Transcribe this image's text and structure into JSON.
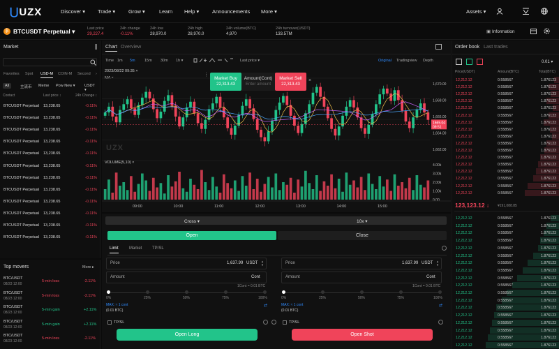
{
  "nav": {
    "logo": "UZX",
    "items": [
      "Discover ▾",
      "Trade ▾",
      "Grow ▾",
      "Learn",
      "Help ▾",
      "Announcements",
      "More ▾"
    ],
    "assets": "Assets ▾"
  },
  "ticker": {
    "symbol": "BTCUSDT Perpetual",
    "stats": [
      {
        "label": "Last price",
        "value": "29,227.4",
        "color": "red"
      },
      {
        "label": "24h change",
        "value": "-0.11%",
        "color": "red"
      },
      {
        "label": "24h low",
        "value": "28,970.0",
        "color": "normal"
      },
      {
        "label": "24h high",
        "value": "28,970.0",
        "color": "normal"
      },
      {
        "label": "24h volume(BTC)",
        "value": "4,970",
        "color": "normal"
      },
      {
        "label": "24h turnover(USDT)",
        "value": "133.5TM",
        "color": "normal"
      }
    ],
    "information": "Information"
  },
  "market": {
    "title": "Market",
    "tabs": [
      "Favorites",
      "Spot",
      "USD-M",
      "COIN-M",
      "Second"
    ],
    "filters": [
      "All",
      "主流币",
      "Meme",
      "Pow New ▾",
      "USDT ▾"
    ],
    "headers": [
      "Contact",
      "Last price ↕",
      "24h Change ↕"
    ],
    "rows": [
      {
        "name": "BTCUSDT Perpetual",
        "price": "13,238.65",
        "change": "-0.11%"
      },
      {
        "name": "BTCUSDT Perpetual",
        "price": "13,238.65",
        "change": "-0.11%"
      },
      {
        "name": "BTCUSDT Perpetual",
        "price": "13,238.65",
        "change": "-0.11%"
      },
      {
        "name": "BTCUSDT Perpetual",
        "price": "13,238.65",
        "change": "-0.11%"
      },
      {
        "name": "BTCUSDT Perpetual",
        "price": "13,238.65",
        "change": "-0.11%"
      },
      {
        "name": "BTCUSDT Perpetual",
        "price": "13,238.65",
        "change": "-0.11%"
      },
      {
        "name": "BTCUSDT Perpetual",
        "price": "13,238.65",
        "change": "-0.11%"
      },
      {
        "name": "BTCUSDT Perpetual",
        "price": "13,238.65",
        "change": "-0.11%"
      },
      {
        "name": "BTCUSDT Perpetual",
        "price": "13,238.65",
        "change": "-0.11%"
      },
      {
        "name": "BTCUSDT Perpetual",
        "price": "13,238.65",
        "change": "-0.11%"
      },
      {
        "name": "BTCUSDT Perpetual",
        "price": "13,238.65",
        "change": "-0.11%"
      },
      {
        "name": "BTCUSDT Perpetual",
        "price": "13,238.65",
        "change": "-0.11%"
      }
    ]
  },
  "movers": {
    "title": "Top movers",
    "more": "More ▸",
    "rows": [
      {
        "pair": "BTC/USDT",
        "time": "08/23 12:00",
        "type": "5-min loss",
        "change": "-2.11%",
        "dir": "down"
      },
      {
        "pair": "BTC/USDT",
        "time": "08/23 12:00",
        "type": "5-min loss",
        "change": "-2.11%",
        "dir": "down"
      },
      {
        "pair": "BTC/USDT",
        "time": "08/23 12:00",
        "type": "5-min gain",
        "change": "+2.11%",
        "dir": "up"
      },
      {
        "pair": "BTC/USDT",
        "time": "08/23 12:00",
        "type": "5-min gain",
        "change": "+2.11%",
        "dir": "up"
      },
      {
        "pair": "BTC/USDT",
        "time": "08/23 12:00",
        "type": "5-min loss",
        "change": "-2.11%",
        "dir": "down"
      }
    ]
  },
  "chart": {
    "tabs": [
      "Chart",
      "Overview"
    ],
    "intervals": [
      "Time",
      "1m",
      "5m",
      "15m",
      "30m",
      "1h ▾"
    ],
    "price_mode": "Last price ▾",
    "views": [
      "Original",
      "Tradingview",
      "Depth"
    ],
    "date": "2023/08/22 09:35 ×",
    "ma": "MA ×",
    "volume_label": "VOLUME(5,10) ×",
    "watermark": "UZX",
    "price_ticks": [
      "1,670.00",
      "1,668.00",
      "1,666.00",
      "1,664.00",
      "1,662.00"
    ],
    "current_price": "1665.04",
    "current_time": "09:51",
    "vol_ticks": [
      "4.00k",
      "3.00k",
      "2.00k",
      "1.00k",
      "0.00"
    ],
    "time_ticks": [
      "09:00",
      "10:00",
      "11:00",
      "12:00",
      "13:00",
      "14:00",
      "15:00"
    ],
    "quick": {
      "buy_label": "Market Buy",
      "buy_price": "22,313.43",
      "amount_label": "Amount(Cont)",
      "amount_placeholder": "Enter amount",
      "sell_label": "Market Sell",
      "sell_price": "22,313.43"
    }
  },
  "chart_data": {
    "type": "candlestick",
    "ylim": [
      1661,
      1671
    ],
    "x_ticks": [
      "09:00",
      "10:00",
      "11:00",
      "12:00",
      "13:00",
      "14:00",
      "15:00"
    ],
    "close": [
      1666.5,
      1667.2,
      1666.0,
      1665.3,
      1666.8,
      1667.5,
      1668.1,
      1667.0,
      1666.2,
      1667.4,
      1668.3,
      1669.0,
      1668.2,
      1666.9,
      1665.8,
      1666.6,
      1667.9,
      1668.6,
      1667.3,
      1666.0,
      1664.8,
      1665.9,
      1667.1,
      1667.8,
      1666.4,
      1665.2,
      1664.5,
      1665.6,
      1666.9,
      1667.6,
      1668.4,
      1667.1,
      1665.9,
      1664.6,
      1663.8,
      1664.9,
      1666.2,
      1667.3,
      1668.1,
      1667.0,
      1665.7,
      1664.4,
      1663.5,
      1663.0,
      1664.2,
      1665.5,
      1666.8,
      1667.7,
      1668.5,
      1667.4,
      1666.1,
      1664.9,
      1664.0,
      1665.1,
      1666.4,
      1667.5,
      1668.9,
      1669.6,
      1668.4,
      1667.2,
      1665.8,
      1664.5,
      1663.7,
      1664.8,
      1666.1,
      1667.2,
      1668.0,
      1667.1,
      1665.9,
      1664.6,
      1663.9,
      1665.0,
      1666.3,
      1667.5,
      1668.7,
      1669.4,
      1668.8,
      1667.9,
      1669.2,
      1668.0,
      1666.7,
      1665.4,
      1664.6,
      1665.9,
      1666.8,
      1667.6,
      1666.5,
      1665.6
    ],
    "volume": [
      1.2,
      2.3,
      0.8,
      3.1,
      1.6,
      2.0,
      1.1,
      2.7,
      0.9,
      1.8,
      3.0,
      2.2,
      1.0,
      2.5,
      1.4,
      1.9,
      0.7,
      2.8,
      1.5,
      2.1,
      3.2,
      1.3,
      0.9,
      2.4,
      1.7,
      1.2,
      3.4,
      2.0,
      1.1,
      2.6,
      1.5,
      0.8,
      2.9,
      1.9,
      1.3,
      2.2,
      1.0,
      2.7,
      1.6,
      3.1,
      1.2,
      2.4,
      0.9,
      1.8,
      2.6,
      1.4,
      3.0,
      1.1,
      2.0,
      1.7,
      2.5,
      0.8,
      2.3,
      1.5,
      3.3,
      1.9,
      1.2,
      2.8,
      1.0,
      2.1,
      1.6,
      2.9,
      1.3,
      2.4,
      0.9,
      3.1,
      1.7,
      2.2,
      1.4,
      2.6,
      1.1,
      3.0,
      1.8,
      1.2,
      2.7,
      1.5,
      2.3,
      1.0,
      2.9,
      1.6,
      2.0,
      1.3,
      2.5,
      1.1,
      2.8,
      1.7,
      1.4,
      2.2
    ]
  },
  "order_form": {
    "margin_mode": "Cross ▾",
    "leverage": "10x ▾",
    "open_tab": "Open",
    "close_tab": "Close",
    "type_tabs": [
      "Limit",
      "Market",
      "TP/SL"
    ],
    "price_label": "Price",
    "price_value": "1,637.99",
    "unit": "USDT",
    "amount_label": "Amount",
    "amount_unit": "Cont",
    "cont_note": "1Cont = 0.01 BTC",
    "slider_ticks": [
      "0%",
      "25%",
      "50%",
      "75%",
      "100%"
    ],
    "max_label": "MAX: ≈ 1 cont",
    "max_btc": "(0.01 BTC)",
    "tpsl": "TP/SL",
    "open_long": "Open Long",
    "open_short": "Open Shot"
  },
  "orderbook": {
    "tabs": [
      "Order book",
      "Last trades"
    ],
    "precision": "0.01 ▾",
    "headers": [
      "Price(USDT)",
      "Amount(BTC)",
      "Total(BTC)"
    ],
    "ask_price": "12,212.12",
    "amount": "0.558567",
    "total": "1.876123",
    "mid_price": "123,123.12 ↓",
    "mid_sub": "¥191,088.85",
    "bid_price": "12,212.12",
    "ask_depth": [
      0.05,
      0.1,
      0.08,
      0.12,
      0.06,
      0.1,
      0.15,
      0.09,
      0.07,
      0.12,
      0.14,
      0.18,
      0.2,
      0.22,
      0.25,
      0.3,
      0.33
    ],
    "bid_depth": [
      0.08,
      0.12,
      0.15,
      0.18,
      0.2,
      0.25,
      0.3,
      0.35,
      0.4,
      0.45,
      0.5,
      0.55,
      0.6,
      0.62,
      0.64,
      0.66,
      0.68,
      0.7
    ]
  },
  "colors": {
    "up": "#22c48a",
    "down": "#f0445a",
    "accent": "#2f8bff"
  }
}
